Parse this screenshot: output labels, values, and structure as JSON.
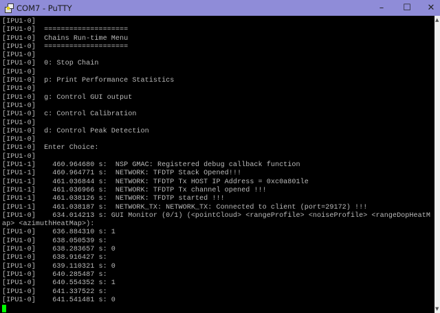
{
  "window": {
    "title": "COM7 - PuTTY",
    "minimize": "–",
    "maximize": "☐",
    "close": "✕"
  },
  "terminal": {
    "lines": [
      "[IPU1-0]",
      "[IPU1-0]  ====================",
      "[IPU1-0]  Chains Run-time Menu",
      "[IPU1-0]  ====================",
      "[IPU1-0]",
      "[IPU1-0]  0: Stop Chain",
      "[IPU1-0]",
      "[IPU1-0]  p: Print Performance Statistics",
      "[IPU1-0]",
      "[IPU1-0]  g: Control GUI output",
      "[IPU1-0]",
      "[IPU1-0]  c: Control Calibration",
      "[IPU1-0]",
      "[IPU1-0]  d: Control Peak Detection",
      "[IPU1-0]",
      "[IPU1-0]  Enter Choice:",
      "[IPU1-0]",
      "[IPU1-1]    460.964680 s:  NSP GMAC: Registered debug callback function",
      "[IPU1-1]    460.964771 s:  NETWORK: TFDTP Stack Opened!!!",
      "[IPU1-1]    461.036844 s:  NETWORK: TFDTP Tx HOST IP Address = 0xc0a801le",
      "[IPU1-1]    461.036966 s:  NETWORK: TFDTP Tx channel opened !!!",
      "[IPU1-1]    461.038126 s:  NETWORK: TFDTP started !!!",
      "[IPU1-1]    461.038187 s:  NETWORK_TX: NETWORK_TX: Connected to client (port=29172) !!!",
      "[IPU1-0]    634.014213 s: GUI Monitor (0/1) (<pointCloud> <rangeProfile> <noiseProfile> <rangeDopHeatM",
      "ap> <azimuthHeatMap>):",
      "[IPU1-0]    636.884310 s: 1",
      "[IPU1-0]    638.050539 s:",
      "[IPU1-0]    638.283657 s: 0",
      "[IPU1-0]    638.916427 s:",
      "[IPU1-0]    639.110321 s: 0",
      "[IPU1-0]    640.285487 s:",
      "[IPU1-0]    640.554352 s: 1",
      "[IPU1-0]    641.337522 s:",
      "[IPU1-0]    641.541481 s: 0"
    ]
  }
}
